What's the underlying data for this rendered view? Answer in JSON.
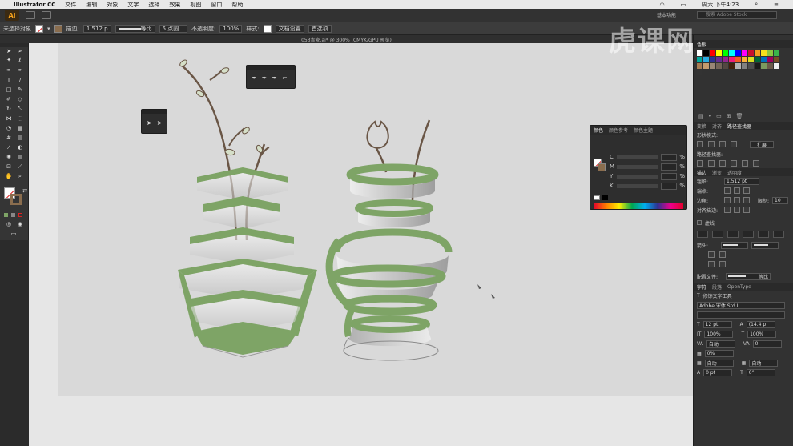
{
  "menubar": {
    "app_name": "Illustrator CC",
    "items": [
      "文件",
      "编辑",
      "对象",
      "文字",
      "选择",
      "效果",
      "视图",
      "窗口",
      "帮助"
    ],
    "clock": "周六 下午4:23"
  },
  "appbar": {
    "logo": "Ai",
    "workspace": "基本功能",
    "search_placeholder": "搜索 Adobe Stock"
  },
  "controlbar": {
    "selection_label": "未选择对象",
    "stroke_label": "描边:",
    "stroke_value": "1.512 p",
    "profile_label": "等比",
    "brush_label": "5 点圆...",
    "opacity_label": "不透明度:",
    "opacity_value": "100%",
    "style_label": "样式:",
    "doc_setup_button": "文档设置",
    "prefs_button": "首选项"
  },
  "document_tab": "053青瓷.ai* @ 300% (CMYK/GPU 预览)",
  "color_panel": {
    "tabs": [
      "颜色",
      "颜色参考",
      "颜色主题"
    ],
    "channels": [
      {
        "label": "C",
        "unit": "%"
      },
      {
        "label": "M",
        "unit": "%"
      },
      {
        "label": "Y",
        "unit": "%"
      },
      {
        "label": "K",
        "unit": "%"
      }
    ]
  },
  "right_panel": {
    "swatches_tab": "色板",
    "transform_tabs": [
      "变换",
      "对齐",
      "路径查找器"
    ],
    "shape_modes_label": "形状模式:",
    "expand_button": "扩展",
    "pathfinder_label": "路径查找器:",
    "stroke_tabs": [
      "描边",
      "渐变",
      "透明度"
    ],
    "weight_label": "粗细:",
    "weight_value": "1.512 pt",
    "cap_label": "端点:",
    "corner_label": "边角:",
    "limit_label": "限制:",
    "limit_value": "10",
    "align_stroke_label": "对齐描边:",
    "dashed_label": "虚线",
    "arrowheads_label": "箭头:",
    "profile_label": "配置文件:",
    "profile_value": "等比",
    "char_tabs": [
      "字符",
      "段落",
      "OpenType"
    ],
    "touch_type_button": "修饰文字工具",
    "font_name": "Adobe 宋体 Std L",
    "font_size": "12 pt",
    "leading": "(14.4 p",
    "vscale": "100%",
    "hscale": "100%",
    "kerning": "自动",
    "tracking": "0",
    "tsume": "0%",
    "aki_left": "自动",
    "aki_right": "自动",
    "baseline": "0 pt",
    "rotation": "0°"
  },
  "swatch_colors": [
    "#ffffff",
    "#000000",
    "#ff0000",
    "#ffff00",
    "#00ff00",
    "#00ffff",
    "#0000ff",
    "#ff00ff",
    "#c8102e",
    "#f29d1f",
    "#f7e11b",
    "#8cc63f",
    "#39b54a",
    "#00a99d",
    "#29abe2",
    "#2e3192",
    "#662d91",
    "#92278f",
    "#ed1e79",
    "#f15a24",
    "#fbb03b",
    "#d9e021",
    "#006837",
    "#0071bc",
    "#9e005d",
    "#754c24",
    "#a67c52",
    "#c69c6d",
    "#998675",
    "#736357",
    "#534741",
    "#42210b",
    "#b3b3b3",
    "#808080",
    "#4d4d4d",
    "#1a1a1a",
    "#7b9a5f",
    "#6b5a4a",
    "#f0f0f0",
    "#333333"
  ],
  "colors": {
    "leaf_green": "#7ea466",
    "stem_brown": "#6a5646",
    "canvas_bg": "#e6e6e6",
    "artboard_bg": "#d9d9d9"
  }
}
